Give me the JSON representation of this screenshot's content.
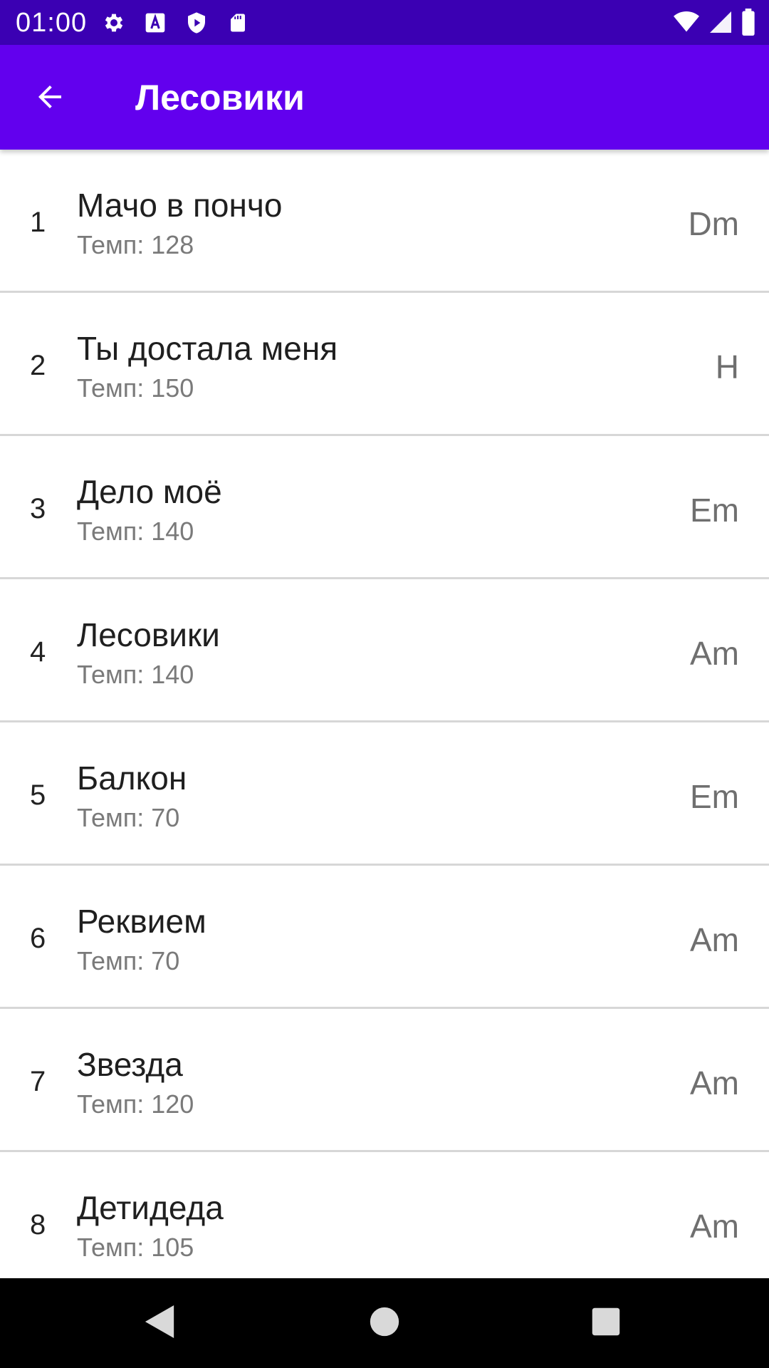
{
  "status_bar": {
    "time": "01:00",
    "left_icons": [
      "gear-icon",
      "font-a-icon",
      "shield-play-icon",
      "sd-card-icon"
    ],
    "right_icons": [
      "wifi-icon",
      "signal-icon",
      "battery-icon"
    ],
    "background": "#3b00b3"
  },
  "app_bar": {
    "title": "Лесовики",
    "back_icon": "arrow-left-icon",
    "background": "#6200ee"
  },
  "songs": [
    {
      "number": "1",
      "title": "Мачо в пончо",
      "tempo": "Темп: 128",
      "key": "Dm"
    },
    {
      "number": "2",
      "title": "Ты достала меня",
      "tempo": "Темп: 150",
      "key": "H"
    },
    {
      "number": "3",
      "title": "Дело моё",
      "tempo": "Темп: 140",
      "key": "Em"
    },
    {
      "number": "4",
      "title": "Лесовики",
      "tempo": "Темп: 140",
      "key": "Am"
    },
    {
      "number": "5",
      "title": "Балкон",
      "tempo": "Темп: 70",
      "key": "Em"
    },
    {
      "number": "6",
      "title": "Реквием",
      "tempo": "Темп: 70",
      "key": "Am"
    },
    {
      "number": "7",
      "title": "Звезда",
      "tempo": "Темп: 120",
      "key": "Am"
    },
    {
      "number": "8",
      "title": "Детидеда",
      "tempo": "Темп: 105",
      "key": "Am"
    }
  ],
  "nav_bar": {
    "buttons": [
      "back-triangle-icon",
      "home-circle-icon",
      "recents-square-icon"
    ]
  }
}
